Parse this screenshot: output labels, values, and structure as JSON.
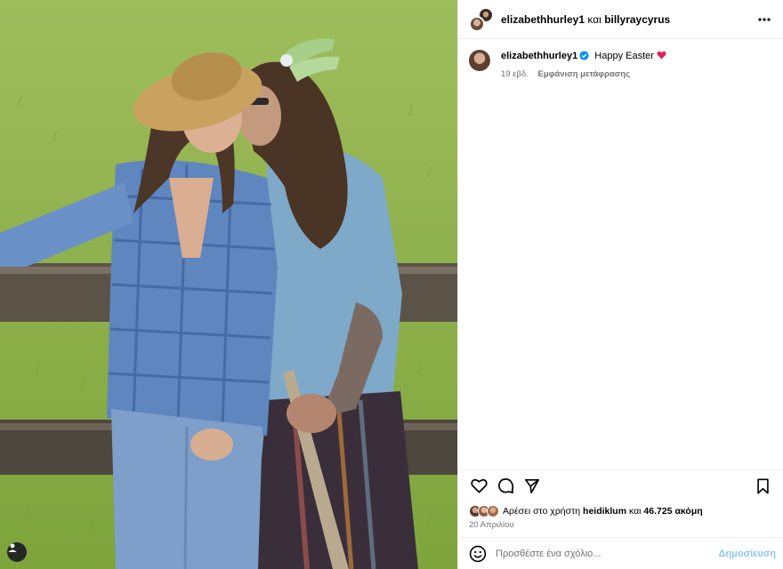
{
  "post": {
    "photo_alt": "",
    "header": {
      "user1": "elizabethhurley1",
      "conj": "και",
      "user2": "billyraycyrus"
    },
    "caption": {
      "username": "elizabethhurley1",
      "text": "Happy Easter",
      "age": "19 εβδ.",
      "translate": "Εμφάνιση μετάφρασης"
    },
    "likes": {
      "prefix": "Αρέσει στο χρήστη",
      "user": "heidiklum",
      "and": "και",
      "count": "46.725 ακόμη"
    },
    "date": "20 Απριλίου",
    "comment": {
      "placeholder": "Προσθέστε ένα σχόλιο...",
      "post_label": "Δημοσίευση"
    }
  },
  "icons": {
    "more": "more-horizontal-icon",
    "like": "heart-icon",
    "comment": "comment-icon",
    "share": "paper-plane-icon",
    "save": "bookmark-icon",
    "emoji": "emoji-icon",
    "verified": "verified-badge-icon",
    "tag": "user-tag-icon",
    "caption_heart": "red-heart-emoji"
  },
  "colors": {
    "verified": "#0095f6",
    "heart_emoji": "#e0245e",
    "post_button_disabled": "#8ec5f7",
    "meta_text": "#737373",
    "divider": "#efefef"
  }
}
